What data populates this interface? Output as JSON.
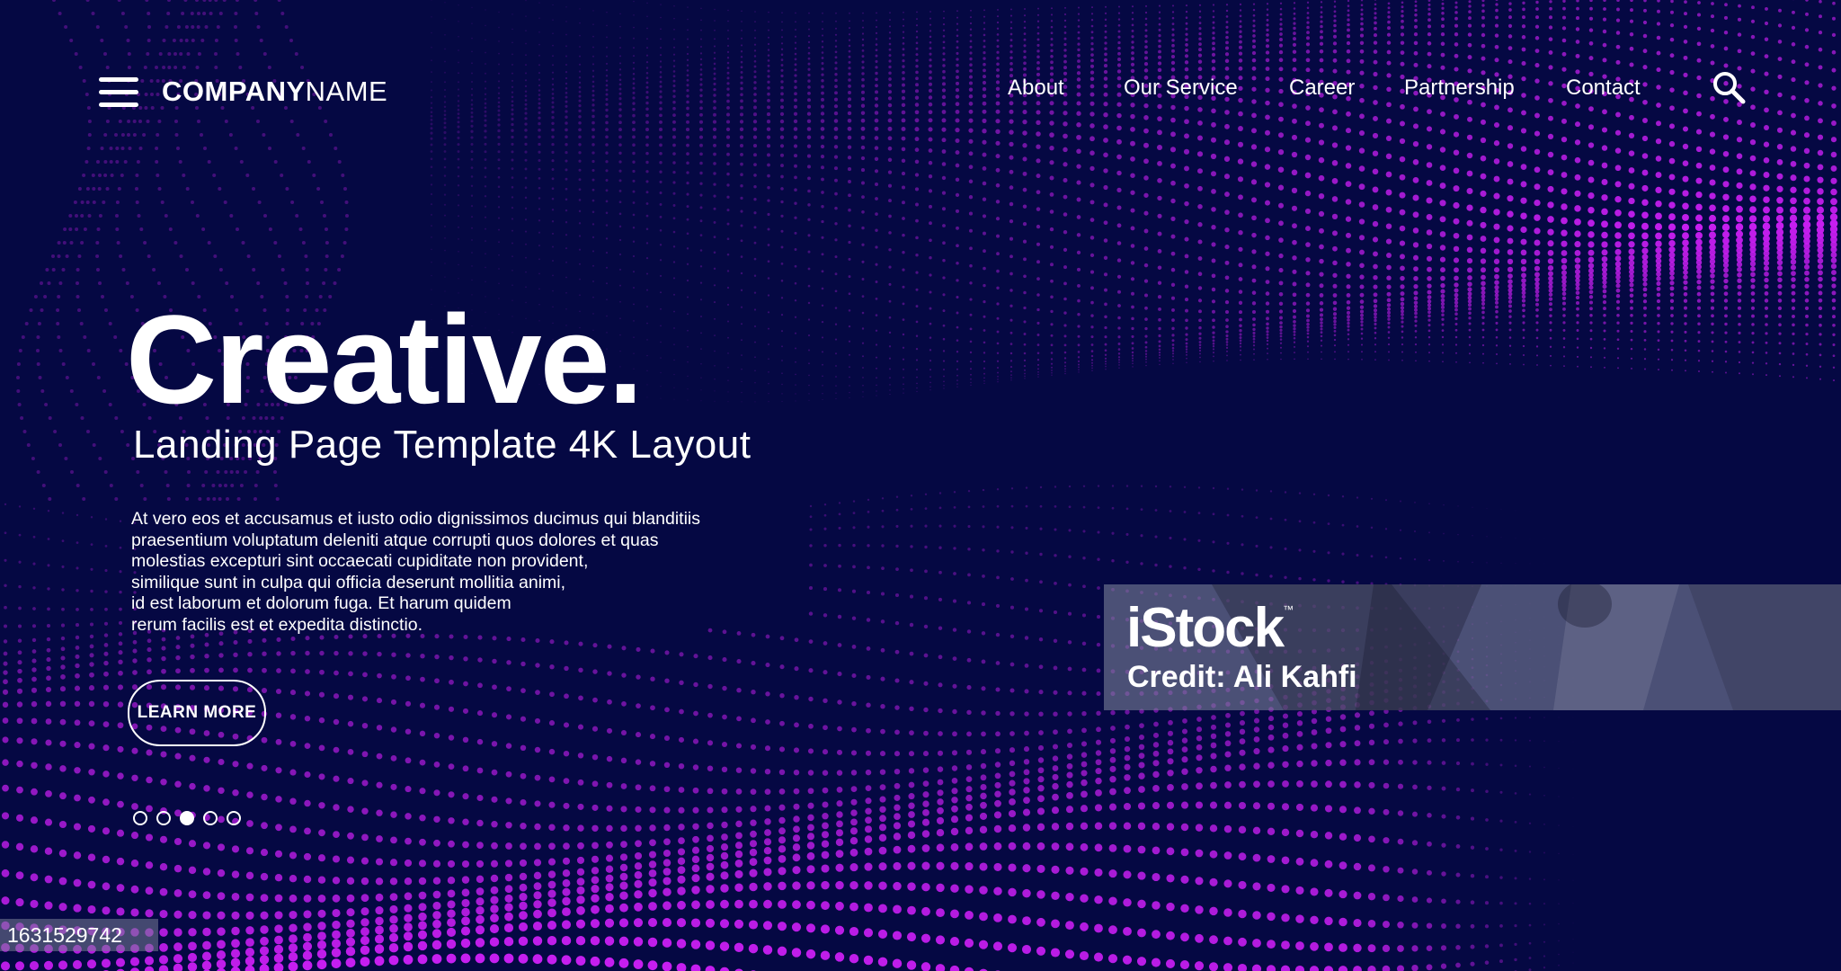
{
  "colors": {
    "background": "#050843",
    "dot_accent": "#c61ef0",
    "text": "#ffffff"
  },
  "header": {
    "menu_icon": "hamburger-menu-icon",
    "brand": {
      "bold": "COMPANY",
      "light": "NAME"
    },
    "nav": [
      {
        "label": "About"
      },
      {
        "label": "Our Service"
      },
      {
        "label": "Career"
      },
      {
        "label": "Partnership"
      },
      {
        "label": "Contact"
      }
    ],
    "search_icon": "search-icon"
  },
  "hero": {
    "title": "Creative.",
    "subtitle": "Landing Page Template 4K Layout",
    "body_lines": [
      "At vero eos et accusamus et iusto odio dignissimos ducimus qui blanditiis",
      "praesentium voluptatum deleniti atque corrupti quos dolores et quas",
      "molestias excepturi sint occaecati cupiditate non provident,",
      "similique sunt in culpa qui officia deserunt mollitia animi,",
      "id est laborum et dolorum fuga. Et harum quidem",
      "rerum facilis est et expedita distinctio."
    ],
    "cta_label": "LEARN MORE",
    "slides": {
      "count": 5,
      "active": 3
    }
  },
  "watermark": {
    "logo": "iStock",
    "trademark": "™",
    "credit": "Credit: Ali Kahfi",
    "image_id": "1631529742"
  }
}
